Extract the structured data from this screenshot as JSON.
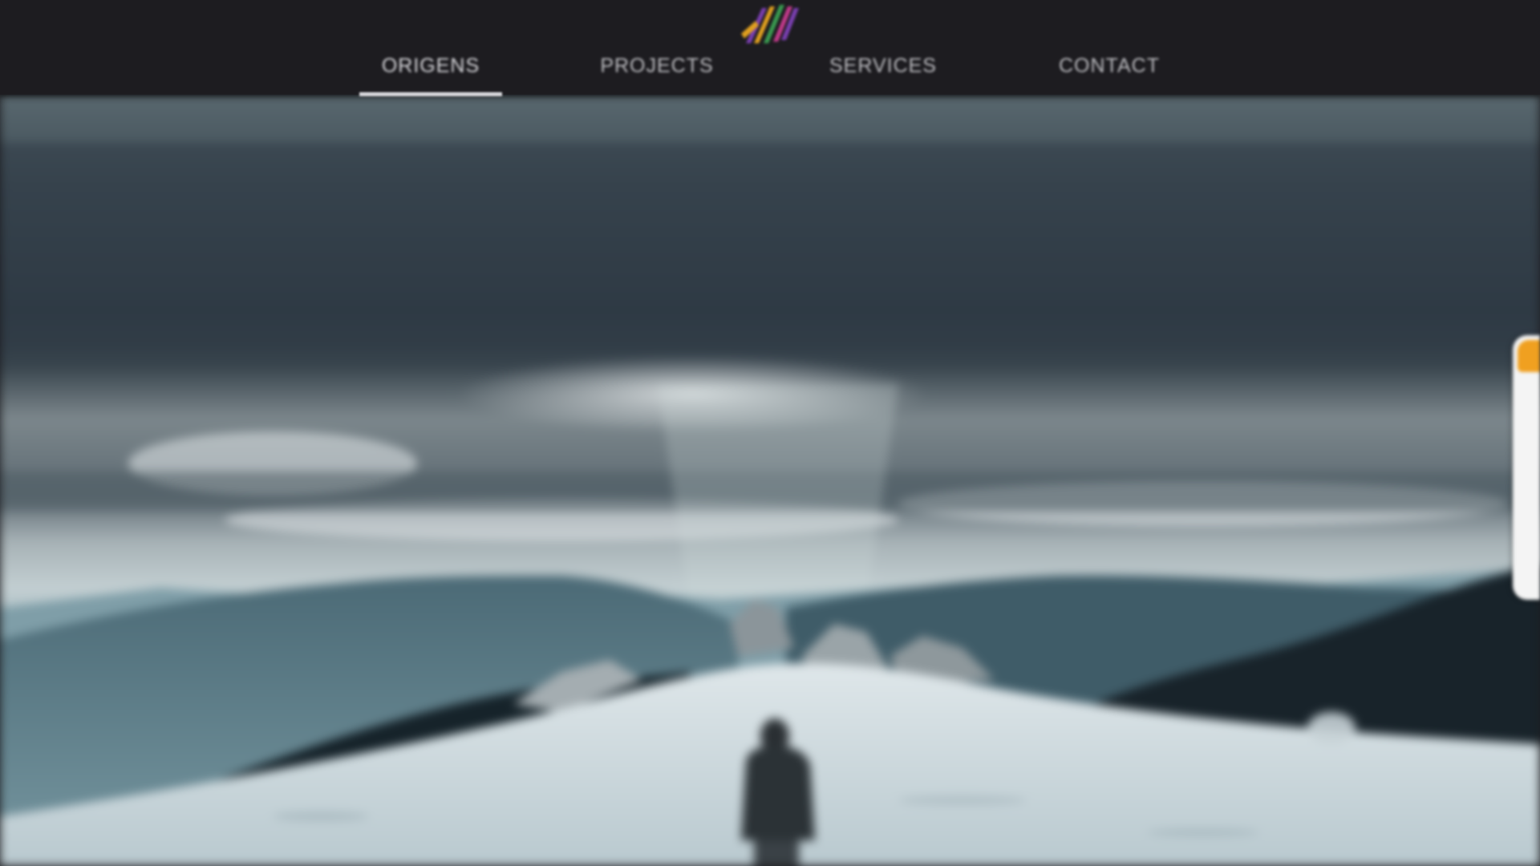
{
  "header": {
    "logo_icon": "brand-logo-icon",
    "nav": [
      {
        "label": "ORIGENS",
        "active": true
      },
      {
        "label": "PROJECTS",
        "active": false
      },
      {
        "label": "SERVICES",
        "active": false
      },
      {
        "label": "CONTACT",
        "active": false
      }
    ]
  },
  "hero": {
    "image": "snowy-mountain-summit-hiker-photo"
  },
  "edge_tab": {
    "icon": "side-feedback-tab",
    "accent_color": "#f0a020"
  },
  "colors": {
    "header_bg": "#1d1c20",
    "nav_text": "#bdbdc1"
  }
}
